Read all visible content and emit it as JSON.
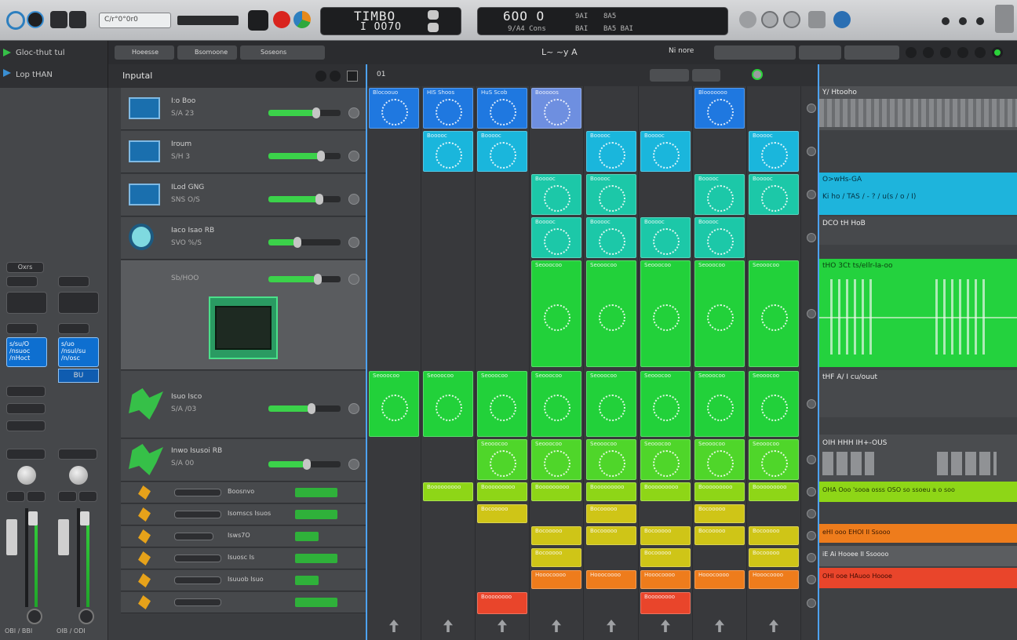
{
  "toolbar": {
    "lcd_main_top": "TIMBO",
    "lcd_main_bottom": "I OO7O",
    "lcd_right_big": "6OO O",
    "lcd_right_small1": "9AI",
    "lcd_right_small2": "BAI",
    "lcd_right_small3": "8A5",
    "lcd_right_small4": "BA5 BAI",
    "lcd_right_sub": "9/A4 Cons",
    "search_text": "C/r°0°0r0"
  },
  "subbar": {
    "center_title": "L~ ~y A",
    "right_label": "Ni nore",
    "tab1": "Hoeesse",
    "tab2": "Bsomoone",
    "tab3": "Soseons"
  },
  "left_top": {
    "row1": "Gloc-thut tul",
    "row2": "Lop tHAN"
  },
  "tracks_header": {
    "label": "Inputal"
  },
  "grid_header": {
    "label": "01"
  },
  "tracks": [
    {
      "name": "I:o Boo",
      "sub": "S/A 23"
    },
    {
      "name": "Iroum",
      "sub": "S/H  3"
    },
    {
      "name": "ILod GNG",
      "sub": "SNS  O/S"
    },
    {
      "name": "Iaco Isao RB",
      "sub": "SVO  %/S"
    },
    {
      "name": "",
      "sub": "Sb/HOO"
    },
    {
      "name": "Isuo Isco",
      "sub": "S/A  /03"
    },
    {
      "name": "Inwo Isusoi RB",
      "sub": "S/A  00"
    },
    {
      "name": "Boosnvo",
      "sub": ""
    },
    {
      "name": "Isomscs Isuos",
      "sub": ""
    },
    {
      "name": "Isws7O",
      "sub": ""
    },
    {
      "name": "Isuosc Is",
      "sub": ""
    },
    {
      "name": "Isuuob Isuo",
      "sub": ""
    },
    {
      "name": "",
      "sub": ""
    }
  ],
  "mixer": {
    "top_label": "Oxrs",
    "plugin1": "s/su/O /nsuoc /nHoct",
    "plugin2": "s/uo /nsul/su /n/osc",
    "plugin_tag": "BU",
    "footer1": "OBI / BBI",
    "footer2": "OIB / ODI"
  },
  "timeline": {
    "r1": "Y/ Htooho",
    "r2": "O>wHs-GA",
    "r2b": "Ki ho / TAS / - ? / u(s / o / I)",
    "r3": "DCO tH HoB",
    "r4": "tHO 3Ct ts/eIlr-Ia-oo",
    "r5": "tHF A/ I cu/ouut",
    "r6": "OIH HHH IH+-OUS",
    "r7": "OHA Ooo 'sooa osss OSO  so ssoeu a  o soo",
    "r8": "eHI  ooo  EHOI II   Ssooo",
    "r9": "iE Ai  Hooee II  Ssoooo",
    "r10": "OHI  ooe  HAuoo  Hoooe"
  },
  "clips": {
    "blue1": "Blocoouo",
    "blue2": "HIS Shoos",
    "blue3": "HuS Scob",
    "blue4": "Booooos",
    "blue5": "Blooooooo",
    "teal": "Booooc",
    "green": "Seooocoo",
    "lime": "Booooooooo",
    "yellow": "Bocooooo",
    "orange": "Hooocoooo",
    "red": "Boooooooo"
  },
  "colors": {
    "blue": "#1f78e0",
    "cyan": "#1ab6dc",
    "teal": "#1cc8a8",
    "green": "#22d13a",
    "lime": "#8ed617",
    "yellow": "#cfc517",
    "orange": "#ee7c1c",
    "red": "#e9452b",
    "accent": "#4da2f5"
  }
}
